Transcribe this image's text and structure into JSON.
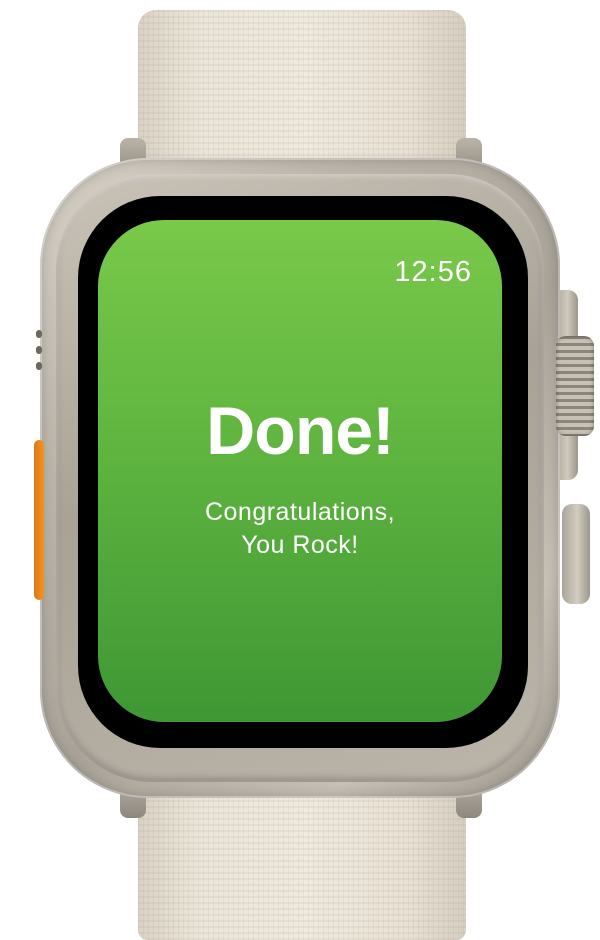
{
  "watch": {
    "time": "12:56",
    "title": "Done!",
    "subtitle_line1": "Congratulations,",
    "subtitle_line2": "You Rock!"
  },
  "colors": {
    "screen_top": "#79c94a",
    "screen_bottom": "#3f9734",
    "text": "#ffffff",
    "action_button": "#f2921f",
    "band": "#ebe5d9"
  },
  "icons": {
    "crown": "digital-crown-icon"
  }
}
